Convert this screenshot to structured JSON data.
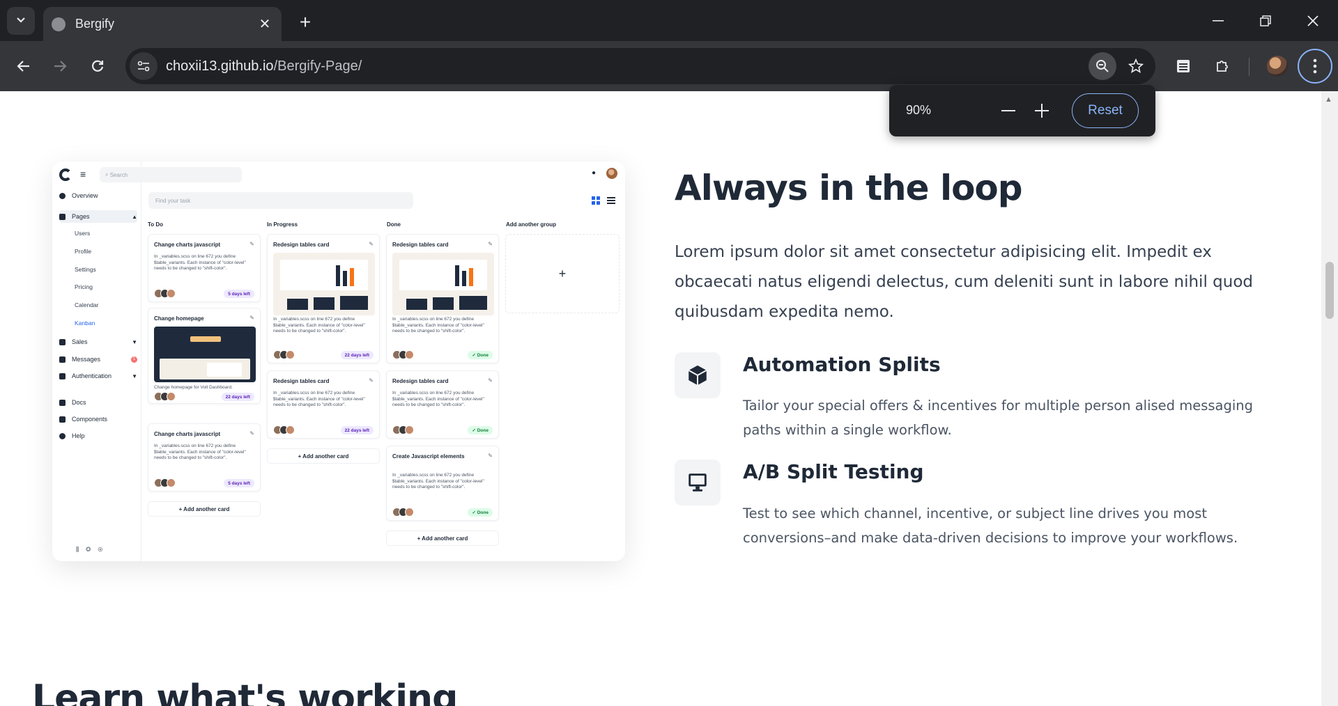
{
  "browser": {
    "tab_title": "Bergify",
    "url_host": "choxii13.github.io",
    "url_path": "/Bergify-Page/",
    "zoom": {
      "level": "90%",
      "reset_label": "Reset"
    }
  },
  "mockup": {
    "search_placeholder": "Search",
    "find_placeholder": "Find your task",
    "sidebar": {
      "overview": "Overview",
      "pages": "Pages",
      "sub_items": [
        "Users",
        "Profile",
        "Settings",
        "Pricing",
        "Calendar",
        "Kanban"
      ],
      "sales": "Sales",
      "messages": "Messages",
      "messages_badge": "1",
      "authentication": "Authentication",
      "docs": "Docs",
      "components": "Components",
      "help": "Help"
    },
    "columns": {
      "todo": "To Do",
      "in_progress": "In Progress",
      "done": "Done",
      "add_group": "Add another group"
    },
    "card_desc": "In _variables.scss on line 672 you define $table_variants. Each instance of \"color-level\" needs to be changed to \"shift-color\".",
    "card_desc_homepage": "Change homepage for Volt Dashboard.",
    "cards": {
      "change_charts": "Change charts javascript",
      "change_homepage": "Change homepage",
      "redesign_tables": "Redesign tables card",
      "create_js": "Create Javascript elements",
      "badge_5_days": "5 days left",
      "badge_22_days": "22 days left",
      "badge_done": "✓ Done"
    },
    "add_card": "+ Add another card",
    "plus": "+"
  },
  "section": {
    "heading": "Always in the loop",
    "lead": "Lorem ipsum dolor sit amet consectetur adipisicing elit. Impedit ex obcaecati natus eligendi delectus, cum deleniti sunt in labore nihil quod quibusdam expedita nemo.",
    "features": [
      {
        "icon": "cube-icon",
        "title": "Automation Splits",
        "text": "Tailor your special offers & incentives for multiple person alised messaging paths within a single workflow."
      },
      {
        "icon": "monitor-icon",
        "title": "A/B Split Testing",
        "text": "Test to see which channel, incentive, or subject line drives you most conversions–and make data-driven decisions to improve your workflows."
      }
    ],
    "next_heading": "Learn what's working"
  }
}
